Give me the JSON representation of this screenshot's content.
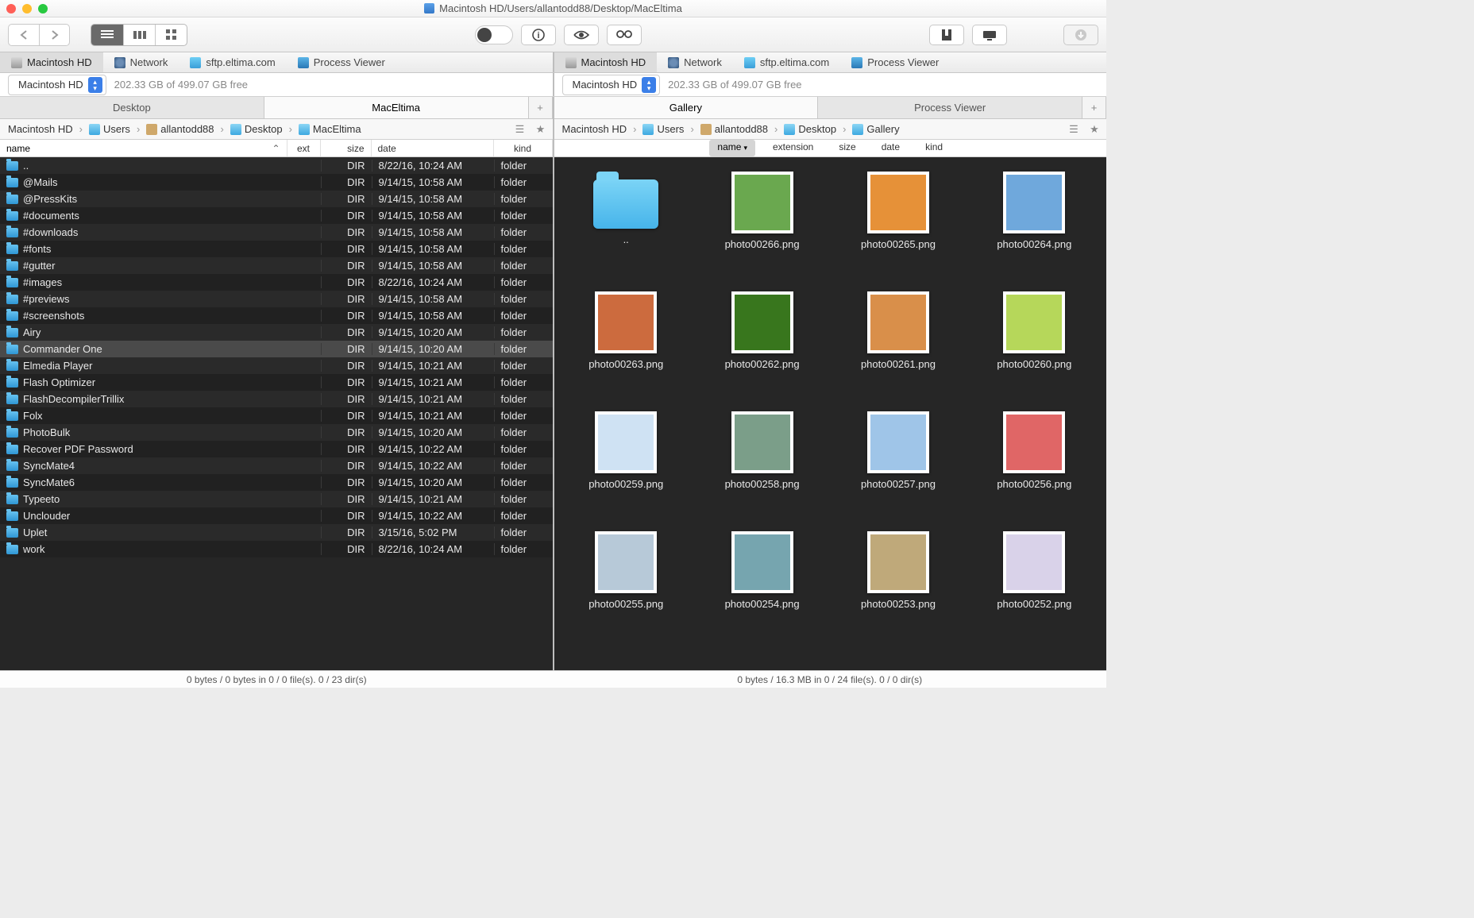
{
  "window": {
    "title": "Macintosh HD/Users/allantodd88/Desktop/MacEltima"
  },
  "shortcuts": [
    {
      "label": "Macintosh HD",
      "icon": "hd",
      "active": true
    },
    {
      "label": "Network",
      "icon": "net",
      "active": false
    },
    {
      "label": "sftp.eltima.com",
      "icon": "sftp",
      "active": false
    },
    {
      "label": "Process Viewer",
      "icon": "proc",
      "active": false
    }
  ],
  "drive": {
    "name": "Macintosh HD",
    "free": "202.33 GB of 499.07 GB free"
  },
  "left": {
    "tabs": [
      {
        "label": "Desktop",
        "active": false
      },
      {
        "label": "MacEltima",
        "active": true
      }
    ],
    "crumbs": [
      "Macintosh HD",
      "Users",
      "allantodd88",
      "Desktop",
      "MacEltima"
    ],
    "cols": {
      "name": "name",
      "ext": "ext",
      "size": "size",
      "date": "date",
      "kind": "kind"
    },
    "selected": "Commander One",
    "rows": [
      {
        "n": "..",
        "ext": "",
        "s": "DIR",
        "d": "8/22/16, 10:24 AM",
        "k": "folder"
      },
      {
        "n": "@Mails",
        "ext": "",
        "s": "DIR",
        "d": "9/14/15, 10:58 AM",
        "k": "folder"
      },
      {
        "n": "@PressKits",
        "ext": "",
        "s": "DIR",
        "d": "9/14/15, 10:58 AM",
        "k": "folder"
      },
      {
        "n": "#documents",
        "ext": "",
        "s": "DIR",
        "d": "9/14/15, 10:58 AM",
        "k": "folder"
      },
      {
        "n": "#downloads",
        "ext": "",
        "s": "DIR",
        "d": "9/14/15, 10:58 AM",
        "k": "folder"
      },
      {
        "n": "#fonts",
        "ext": "",
        "s": "DIR",
        "d": "9/14/15, 10:58 AM",
        "k": "folder"
      },
      {
        "n": "#gutter",
        "ext": "",
        "s": "DIR",
        "d": "9/14/15, 10:58 AM",
        "k": "folder"
      },
      {
        "n": "#images",
        "ext": "",
        "s": "DIR",
        "d": "8/22/16, 10:24 AM",
        "k": "folder"
      },
      {
        "n": "#previews",
        "ext": "",
        "s": "DIR",
        "d": "9/14/15, 10:58 AM",
        "k": "folder"
      },
      {
        "n": "#screenshots",
        "ext": "",
        "s": "DIR",
        "d": "9/14/15, 10:58 AM",
        "k": "folder"
      },
      {
        "n": "Airy",
        "ext": "",
        "s": "DIR",
        "d": "9/14/15, 10:20 AM",
        "k": "folder"
      },
      {
        "n": "Commander One",
        "ext": "",
        "s": "DIR",
        "d": "9/14/15, 10:20 AM",
        "k": "folder"
      },
      {
        "n": "Elmedia Player",
        "ext": "",
        "s": "DIR",
        "d": "9/14/15, 10:21 AM",
        "k": "folder"
      },
      {
        "n": "Flash Optimizer",
        "ext": "",
        "s": "DIR",
        "d": "9/14/15, 10:21 AM",
        "k": "folder"
      },
      {
        "n": "FlashDecompilerTrillix",
        "ext": "",
        "s": "DIR",
        "d": "9/14/15, 10:21 AM",
        "k": "folder"
      },
      {
        "n": "Folx",
        "ext": "",
        "s": "DIR",
        "d": "9/14/15, 10:21 AM",
        "k": "folder"
      },
      {
        "n": "PhotoBulk",
        "ext": "",
        "s": "DIR",
        "d": "9/14/15, 10:20 AM",
        "k": "folder"
      },
      {
        "n": "Recover PDF Password",
        "ext": "",
        "s": "DIR",
        "d": "9/14/15, 10:22 AM",
        "k": "folder"
      },
      {
        "n": "SyncMate4",
        "ext": "",
        "s": "DIR",
        "d": "9/14/15, 10:22 AM",
        "k": "folder"
      },
      {
        "n": "SyncMate6",
        "ext": "",
        "s": "DIR",
        "d": "9/14/15, 10:20 AM",
        "k": "folder"
      },
      {
        "n": "Typeeto",
        "ext": "",
        "s": "DIR",
        "d": "9/14/15, 10:21 AM",
        "k": "folder"
      },
      {
        "n": "Unclouder",
        "ext": "",
        "s": "DIR",
        "d": "9/14/15, 10:22 AM",
        "k": "folder"
      },
      {
        "n": "Uplet",
        "ext": "",
        "s": "DIR",
        "d": "3/15/16, 5:02 PM",
        "k": "folder"
      },
      {
        "n": "work",
        "ext": "",
        "s": "DIR",
        "d": "8/22/16, 10:24 AM",
        "k": "folder"
      }
    ],
    "status": "0 bytes / 0 bytes in 0 / 0 file(s). 0 / 23 dir(s)"
  },
  "right": {
    "tabs": [
      {
        "label": "Gallery",
        "active": true
      },
      {
        "label": "Process Viewer",
        "active": false
      }
    ],
    "crumbs": [
      "Macintosh HD",
      "Users",
      "allantodd88",
      "Desktop",
      "Gallery"
    ],
    "sort": {
      "name": "name",
      "extension": "extension",
      "size": "size",
      "date": "date",
      "kind": "kind"
    },
    "items": [
      {
        "n": "..",
        "folder": true
      },
      {
        "n": "photo00266.png",
        "c": "#6aa84f"
      },
      {
        "n": "photo00265.png",
        "c": "#e69138"
      },
      {
        "n": "photo00264.png",
        "c": "#6fa8dc"
      },
      {
        "n": "photo00263.png",
        "c": "#cc6b3e"
      },
      {
        "n": "photo00262.png",
        "c": "#38761d"
      },
      {
        "n": "photo00261.png",
        "c": "#d98f4a"
      },
      {
        "n": "photo00260.png",
        "c": "#b6d75a"
      },
      {
        "n": "photo00259.png",
        "c": "#cfe2f3"
      },
      {
        "n": "photo00258.png",
        "c": "#7b9e89"
      },
      {
        "n": "photo00257.png",
        "c": "#9fc5e8"
      },
      {
        "n": "photo00256.png",
        "c": "#e06666"
      },
      {
        "n": "photo00255.png",
        "c": "#b7c9d8"
      },
      {
        "n": "photo00254.png",
        "c": "#76a5af"
      },
      {
        "n": "photo00253.png",
        "c": "#bfa97a"
      },
      {
        "n": "photo00252.png",
        "c": "#d9d2e9"
      }
    ],
    "status": "0 bytes / 16.3 MB in 0 / 24 file(s). 0 / 0 dir(s)"
  }
}
